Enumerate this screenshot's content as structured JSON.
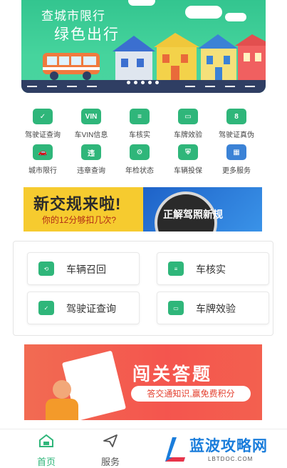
{
  "banner": {
    "line1": "查城市限行",
    "line2": "绿色出行",
    "carousel_count": 5
  },
  "services": [
    {
      "label": "驾驶证查询",
      "icon": "license-card-icon",
      "glyph": "✓"
    },
    {
      "label": "车VIN信息",
      "icon": "vin-icon",
      "glyph": "VIN"
    },
    {
      "label": "车核实",
      "icon": "id-card-icon",
      "glyph": "≡"
    },
    {
      "label": "车牌效验",
      "icon": "plate-check-icon",
      "glyph": "▭"
    },
    {
      "label": "驾驶证真伪",
      "icon": "authenticity-icon",
      "glyph": "8"
    },
    {
      "label": "城市限行",
      "icon": "car-limit-icon",
      "glyph": "🚗"
    },
    {
      "label": "违章查询",
      "icon": "violation-icon",
      "glyph": "违"
    },
    {
      "label": "年检状态",
      "icon": "inspection-icon",
      "glyph": "⚙"
    },
    {
      "label": "车辆投保",
      "icon": "insurance-icon",
      "glyph": "⛨"
    },
    {
      "label": "更多服务",
      "icon": "more-grid-icon",
      "glyph": "▦"
    }
  ],
  "ad": {
    "headline": "新交规来啦!",
    "subline": "你的12分够扣几次?",
    "right_text": "正解驾照新规"
  },
  "quick": [
    {
      "label": "车辆召回",
      "icon": "car-recall-icon"
    },
    {
      "label": "车核实",
      "icon": "id-card-icon"
    },
    {
      "label": "驾驶证查询",
      "icon": "license-card-icon"
    },
    {
      "label": "车牌效验",
      "icon": "plate-check-icon"
    }
  ],
  "quiz": {
    "title": "闯关答题",
    "subtitle": "答交通知识,赢免费积分"
  },
  "tabs": [
    {
      "label": "首页",
      "icon": "home-icon",
      "active": true
    },
    {
      "label": "服务",
      "icon": "send-icon",
      "active": false
    }
  ],
  "watermark": {
    "name": "蓝波攻略网",
    "domain": "LBTDOC.COM"
  },
  "colors": {
    "accent": "#2fb67a",
    "banner_green": "#3ccd96",
    "quiz_red": "#f4554e",
    "ad_yellow": "#f6cb2f"
  }
}
